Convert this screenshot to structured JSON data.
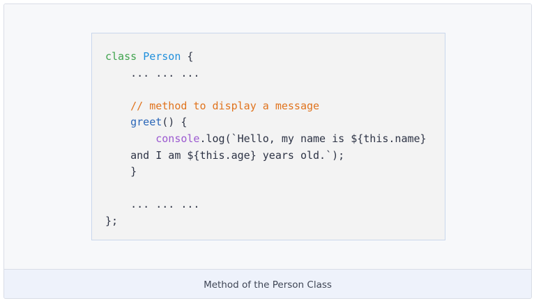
{
  "code_block": {
    "lines": [
      [
        {
          "t": "class",
          "c": "kw"
        },
        {
          "t": " "
        },
        {
          "t": "Person",
          "c": "cls"
        },
        {
          "t": " {"
        }
      ],
      [
        {
          "t": "    ... ... ..."
        }
      ],
      [
        {
          "t": ""
        }
      ],
      [
        {
          "t": "    "
        },
        {
          "t": "// method to display a message",
          "c": "cm"
        }
      ],
      [
        {
          "t": "    "
        },
        {
          "t": "greet",
          "c": "fn"
        },
        {
          "t": "() {"
        }
      ],
      [
        {
          "t": "        "
        },
        {
          "t": "console",
          "c": "obj"
        },
        {
          "t": ".log(`Hello, my name is ${this.name}"
        }
      ],
      [
        {
          "t": "    and I am ${this.age} years old.`);"
        }
      ],
      [
        {
          "t": "    }"
        }
      ],
      [
        {
          "t": ""
        }
      ],
      [
        {
          "t": "    ... ... ..."
        }
      ],
      [
        {
          "t": "};"
        }
      ]
    ]
  },
  "caption": "Method of the Person Class",
  "colors": {
    "keyword": "#3fa34d",
    "class_name": "#1f8fdc",
    "comment": "#e0731d",
    "function_name": "#2a66b8",
    "object_name": "#9b59d0",
    "plain_text": "#2d3345"
  }
}
